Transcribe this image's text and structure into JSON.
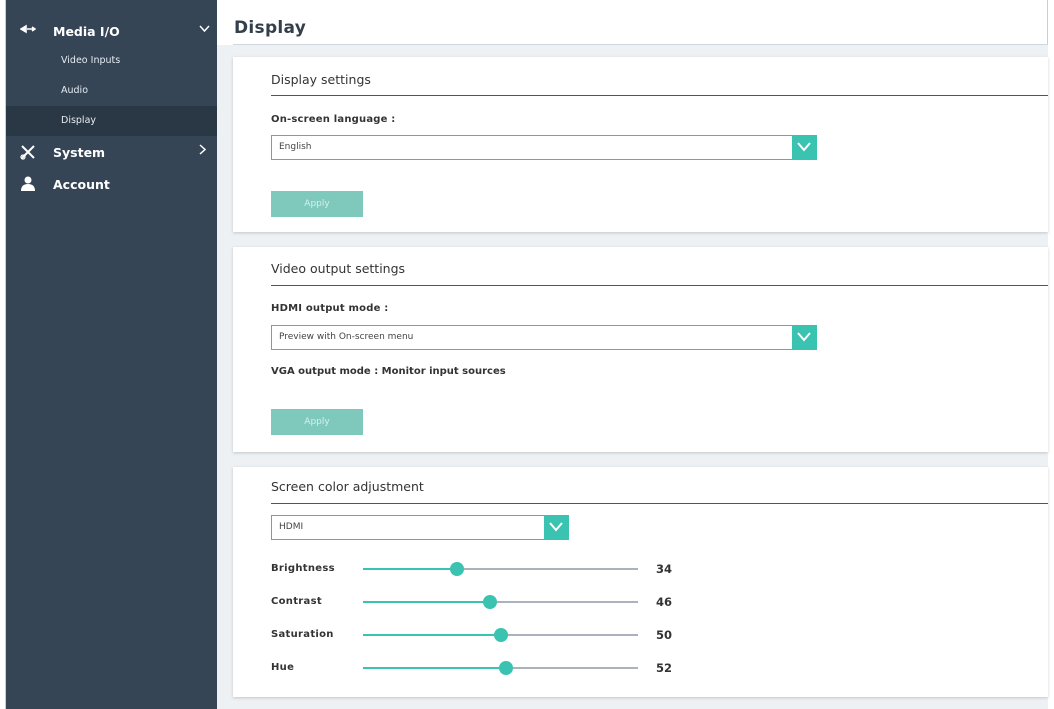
{
  "sidebar": {
    "media_io": {
      "label": "Media I/O",
      "icon": "media-icon"
    },
    "items": [
      {
        "label": "Video Inputs"
      },
      {
        "label": "Audio"
      },
      {
        "label": "Display"
      }
    ],
    "system": {
      "label": "System",
      "icon": "tools-icon"
    },
    "account": {
      "label": "Account",
      "icon": "user-icon"
    }
  },
  "page": {
    "title": "Display"
  },
  "display_settings": {
    "title": "Display settings",
    "language_label": "On-screen language :",
    "language_value": "English",
    "apply_label": "Apply"
  },
  "video_output": {
    "title": "Video output settings",
    "hdmi_label": "HDMI output mode :",
    "hdmi_value": "Preview with On-screen menu",
    "vga_text": "VGA output mode : Monitor input sources",
    "apply_label": "Apply"
  },
  "color_adjust": {
    "title": "Screen color adjustment",
    "source_value": "HDMI",
    "sliders": [
      {
        "label": "Brightness",
        "value": 34
      },
      {
        "label": "Contrast",
        "value": 46
      },
      {
        "label": "Saturation",
        "value": 50
      },
      {
        "label": "Hue",
        "value": 52
      }
    ]
  },
  "colors": {
    "sidebar": "#354555",
    "accent": "#39c3b0",
    "button": "#7ec9bc"
  }
}
